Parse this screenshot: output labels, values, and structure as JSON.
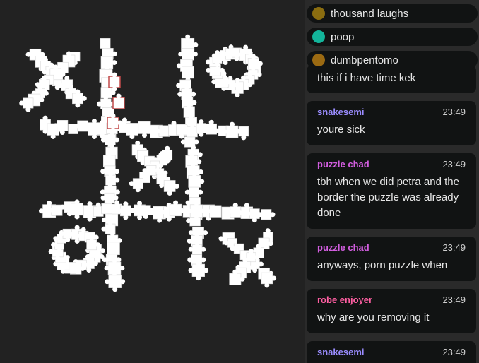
{
  "board": {
    "game": "tic-tac-toe made of jigsaw pieces",
    "marks": [
      {
        "cell": "top-left",
        "symbol": "X"
      },
      {
        "cell": "top-right",
        "symbol": "O"
      },
      {
        "cell": "center",
        "symbol": "X"
      },
      {
        "cell": "bottom-left",
        "symbol": "O"
      },
      {
        "cell": "bottom-right",
        "symbol": "X"
      }
    ]
  },
  "users": [
    {
      "name": "thousand laughs",
      "color": "#8a6d10"
    },
    {
      "name": "poop",
      "color": "#13b59b"
    },
    {
      "name": "dumbpentomo",
      "color": "#9b6a12"
    }
  ],
  "messages": [
    {
      "author": "",
      "time": "",
      "text": "this if i have time kek",
      "author_color": "#9a8cff"
    },
    {
      "author": "snakesemi",
      "time": "23:49",
      "text": "youre sick",
      "author_color": "#9a8cff"
    },
    {
      "author": "puzzle chad",
      "time": "23:49",
      "text": "tbh when we did petra and the border the puzzle was already done",
      "author_color": "#d35ee0"
    },
    {
      "author": "puzzle chad",
      "time": "23:49",
      "text": "anyways, porn puzzle when",
      "author_color": "#d35ee0"
    },
    {
      "author": "robe enjoyer",
      "time": "23:49",
      "text": "why are you removing it",
      "author_color": "#ff5fa2"
    },
    {
      "author": "snakesemi",
      "time": "23:49",
      "text": "",
      "author_color": "#9a8cff"
    }
  ]
}
